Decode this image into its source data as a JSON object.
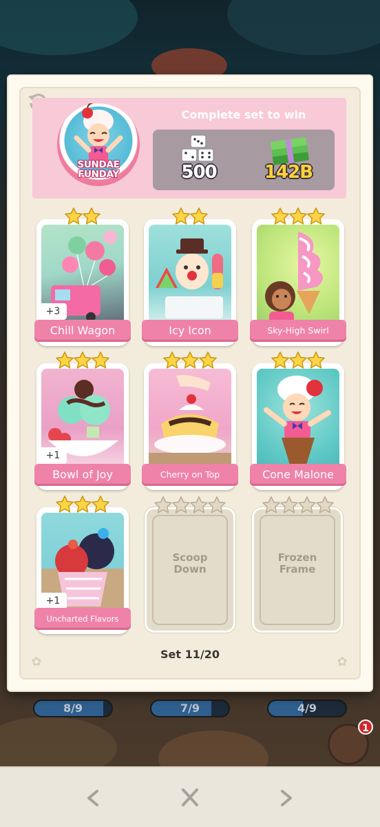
{
  "set": {
    "name": "SUNDAE FUNDAY",
    "reward_title": "Complete set to win",
    "rewards": {
      "dice_icon": "dice-stack-icon",
      "dice": "500",
      "cash_icon": "cash-stack-icon",
      "cash": "142B"
    },
    "progress": "Set 11/20"
  },
  "stickers": [
    {
      "name": "Chill Wagon",
      "stars": 2,
      "owned": true,
      "duplicates": "+3",
      "colors": [
        "#6fb6d8",
        "#f3a8c6"
      ]
    },
    {
      "name": "Icy Icon",
      "stars": 2,
      "owned": true,
      "duplicates": "",
      "colors": [
        "#8fd9d8",
        "#f7a7b9"
      ]
    },
    {
      "name": "Sky-High Swirl",
      "stars": 3,
      "owned": true,
      "duplicates": "",
      "colors": [
        "#c9ea78",
        "#f5a6c8"
      ]
    },
    {
      "name": "Bowl of Joy",
      "stars": 3,
      "owned": true,
      "duplicates": "+1",
      "colors": [
        "#e8a0c4",
        "#7ed7b8"
      ]
    },
    {
      "name": "Cherry on Top",
      "stars": 3,
      "owned": true,
      "duplicates": "",
      "colors": [
        "#f1a6c9",
        "#f9d36b"
      ]
    },
    {
      "name": "Cone Malone",
      "stars": 3,
      "owned": true,
      "duplicates": "",
      "colors": [
        "#5cc7c4",
        "#f4b6c8"
      ]
    },
    {
      "name": "Uncharted Flavors",
      "stars": 3,
      "owned": true,
      "duplicates": "+1",
      "colors": [
        "#7fd1d8",
        "#d8504a"
      ]
    },
    {
      "name": "Scoop Down",
      "stars": 4,
      "owned": false,
      "duplicates": ""
    },
    {
      "name": "Frozen Frame",
      "stars": 4,
      "owned": false,
      "duplicates": ""
    }
  ],
  "albums_behind": [
    "8/9",
    "7/9",
    "4/9"
  ],
  "album_fill": [
    0.889,
    0.778,
    0.444
  ],
  "notification_count": "1",
  "nav": {
    "prev_icon": "chevron-left-icon",
    "close_icon": "close-icon",
    "next_icon": "chevron-right-icon"
  },
  "colors": {
    "banner_pink": "#ef82a8",
    "header_pink": "#f8c9d6",
    "star_gold": "#ffd445",
    "star_empty": "#e2d8c4"
  }
}
